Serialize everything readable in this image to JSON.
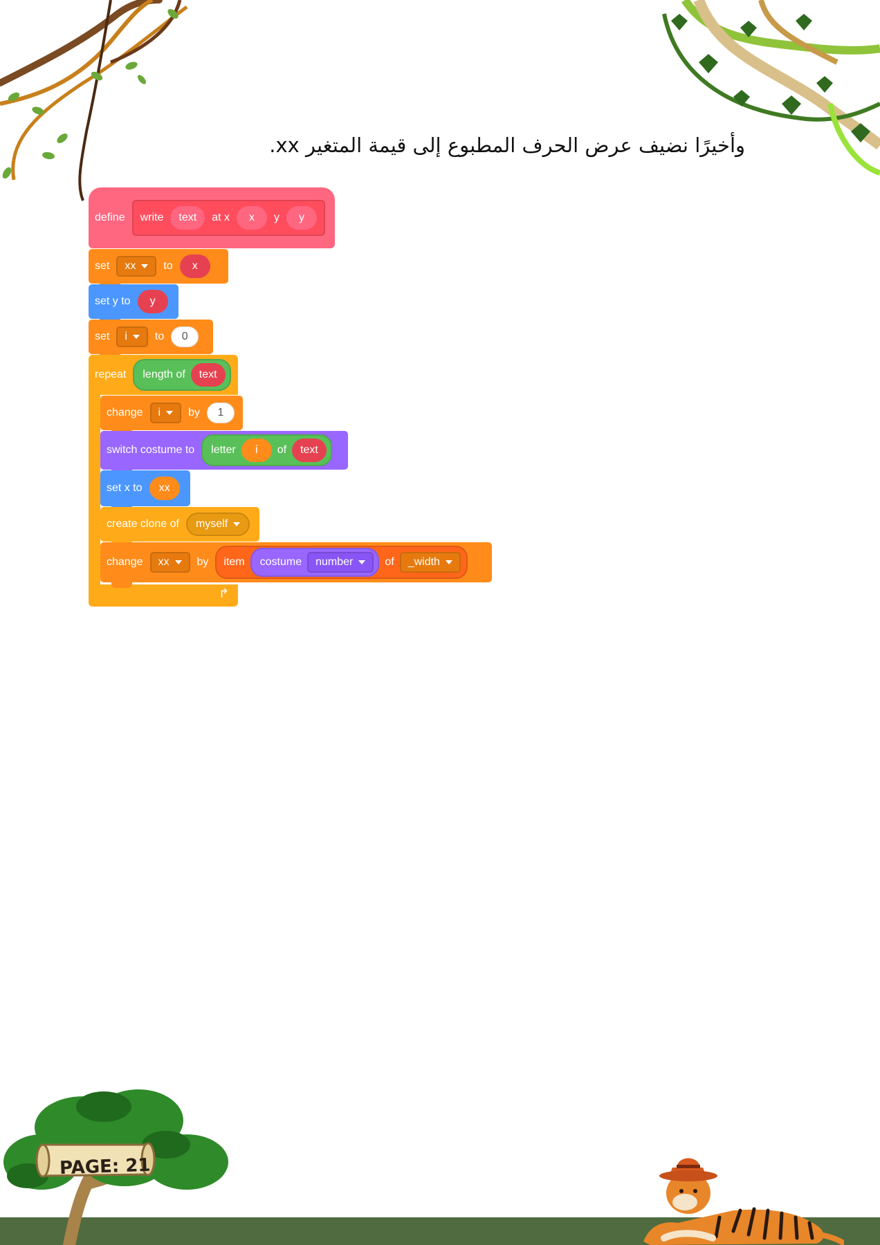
{
  "heading": "وأخيرًا نضيف عرض الحرف المطبوع إلى قيمة المتغير xx.",
  "code": {
    "define": {
      "keyword": "define",
      "custom_name": "write",
      "param1": "text",
      "label_at_x": "at x",
      "param2": "x",
      "label_y": "y",
      "param3": "y"
    },
    "set_xx": {
      "keyword": "set",
      "var": "xx",
      "to": "to",
      "value": "x"
    },
    "set_y": {
      "label": "set y to",
      "value": "y"
    },
    "set_i": {
      "keyword": "set",
      "var": "i",
      "to": "to",
      "value": "0"
    },
    "repeat": {
      "keyword": "repeat",
      "length_label": "length of",
      "arg": "text"
    },
    "change_i": {
      "keyword": "change",
      "var": "i",
      "by": "by",
      "value": "1"
    },
    "switch_costume": {
      "label": "switch costume to",
      "letter": "letter",
      "index": "i",
      "of": "of",
      "source": "text"
    },
    "set_x": {
      "label": "set x to",
      "value": "xx"
    },
    "create_clone": {
      "label": "create clone of",
      "target": "myself"
    },
    "change_xx": {
      "keyword": "change",
      "var": "xx",
      "by": "by",
      "item": "item",
      "costume": "costume",
      "costume_prop": "number",
      "of": "of",
      "list": "_width"
    }
  },
  "footer": {
    "page_label": "PAGE: 21"
  },
  "colors": {
    "my_blocks": "#ff6680",
    "variables": "#ff8c1a",
    "motion": "#4c97ff",
    "control": "#ffab19",
    "operators": "#59c059",
    "looks": "#9966ff",
    "lists": "#ff661a",
    "ground": "#4f6b3f"
  },
  "decorations": [
    "vine-top-left",
    "vine-top-right",
    "tree-bottom-left",
    "tiger-with-hat-bottom-right",
    "ground-strip"
  ]
}
